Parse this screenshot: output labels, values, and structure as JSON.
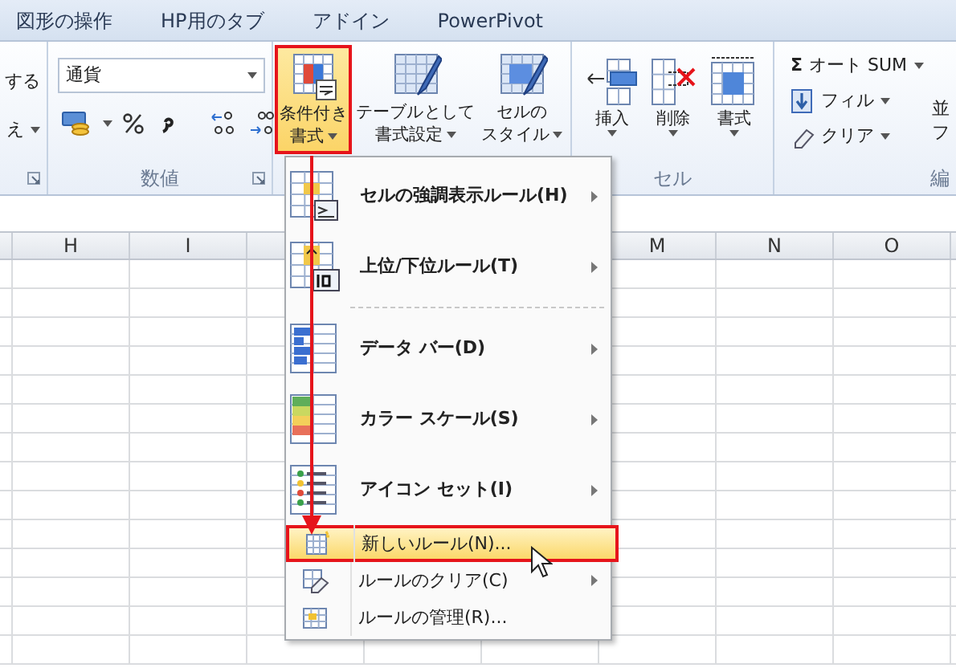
{
  "tabs": [
    {
      "label": "図形の操作"
    },
    {
      "label": "HP用のタブ"
    },
    {
      "label": "アドイン"
    },
    {
      "label": "PowerPivot"
    }
  ],
  "ribbon": {
    "clipped_group": {
      "items": [
        "する",
        "え"
      ]
    },
    "number_group": {
      "format": "通貨",
      "label": "数値"
    },
    "styles_group": {
      "buttons": [
        {
          "lines": [
            "条件付き",
            "書式"
          ],
          "selected": true
        },
        {
          "lines": [
            "テーブルとして",
            "書式設定"
          ],
          "selected": false
        },
        {
          "lines": [
            "セルの",
            "スタイル"
          ],
          "selected": false
        }
      ]
    },
    "cells_group": {
      "buttons": [
        {
          "label": "挿入"
        },
        {
          "label": "削除"
        },
        {
          "label": "書式"
        }
      ],
      "label": "セル"
    },
    "editing_group": {
      "items": [
        {
          "symbol": "Σ",
          "label": "オート SUM"
        },
        {
          "label": "フィル"
        },
        {
          "label": "クリア"
        }
      ],
      "clipped": [
        "並",
        "フ"
      ],
      "label": "編"
    }
  },
  "sheet": {
    "columns": [
      "H",
      "I",
      "",
      "",
      "",
      "M",
      "N",
      "O"
    ]
  },
  "menu": {
    "items": [
      {
        "kind": "large",
        "label": "セルの強調表示ルール(H)",
        "submenu": true,
        "highlighted": false
      },
      {
        "kind": "large",
        "label": "上位/下位ルール(T)",
        "submenu": true,
        "highlighted": false
      },
      {
        "kind": "separator"
      },
      {
        "kind": "large",
        "label": "データ バー(D)",
        "submenu": true,
        "highlighted": false
      },
      {
        "kind": "large",
        "label": "カラー スケール(S)",
        "submenu": true,
        "highlighted": false
      },
      {
        "kind": "large",
        "label": "アイコン セット(I)",
        "submenu": true,
        "highlighted": false
      },
      {
        "kind": "small",
        "label": "新しいルール(N)...",
        "submenu": false,
        "highlighted": true
      },
      {
        "kind": "small",
        "label": "ルールのクリア(C)",
        "submenu": true,
        "highlighted": false
      },
      {
        "kind": "small",
        "label": "ルールの管理(R)...",
        "submenu": false,
        "highlighted": false
      }
    ]
  },
  "callout_arrow": true
}
